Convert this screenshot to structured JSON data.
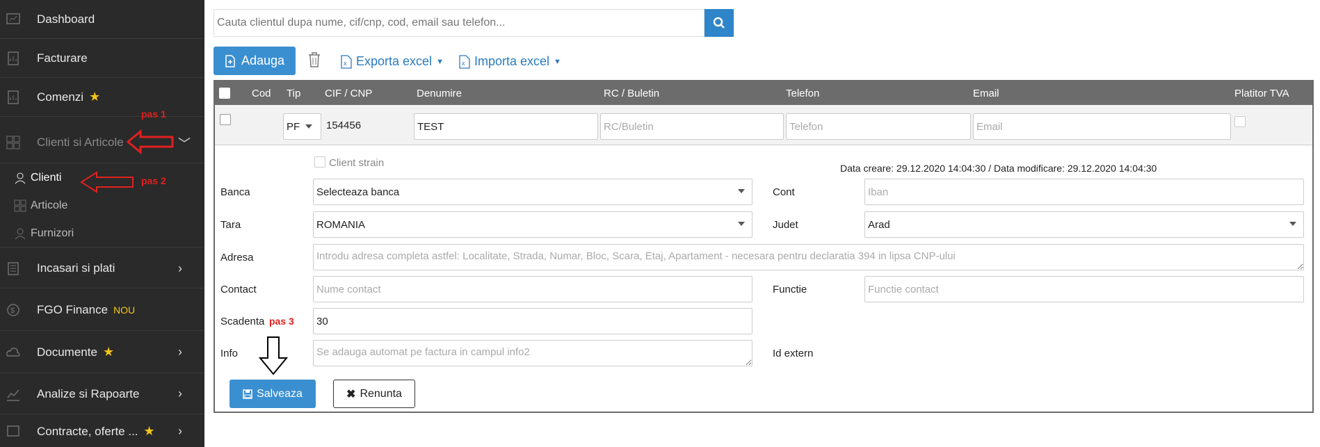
{
  "sidebar": {
    "items": [
      {
        "label": "Dashboard"
      },
      {
        "label": "Facturare"
      },
      {
        "label": "Comenzi"
      },
      {
        "label": "Clienti si Articole",
        "chevron": "﹀"
      },
      {
        "label": "Incasari si plati",
        "chevron": "›"
      },
      {
        "label": "FGO Finance",
        "badge": "NOU"
      },
      {
        "label": "Documente",
        "chevron": "›"
      },
      {
        "label": "Analize si Rapoarte",
        "chevron": "›"
      },
      {
        "label": "Contracte, oferte ...",
        "chevron": "›"
      }
    ],
    "sub_items": [
      {
        "label": "Clienti"
      },
      {
        "label": "Articole"
      },
      {
        "label": "Furnizori"
      }
    ]
  },
  "annotations": {
    "pas1": "pas 1",
    "pas2": "pas 2",
    "pas3": "pas 3"
  },
  "search": {
    "placeholder": "Cauta clientul dupa nume, cif/cnp, cod, email sau telefon..."
  },
  "toolbar": {
    "add_label": "Adauga",
    "export_label": "Exporta excel",
    "import_label": "Importa excel"
  },
  "table": {
    "headers": [
      "Cod",
      "Tip",
      "CIF / CNP",
      "Denumire",
      "RC / Buletin",
      "Telefon",
      "Email",
      "Platitor TVA"
    ],
    "row": {
      "tip": "PF",
      "cif": "154456",
      "denumire": "TEST",
      "rc_placeholder": "RC/Buletin",
      "telefon_placeholder": "Telefon",
      "email_placeholder": "Email"
    }
  },
  "form": {
    "client_strain": "Client strain",
    "dates": "Data creare: 29.12.2020 14:04:30  / Data modificare: 29.12.2020 14:04:30",
    "banca_label": "Banca",
    "banca_value": "Selecteaza banca",
    "cont_label": "Cont",
    "cont_placeholder": "Iban",
    "tara_label": "Tara",
    "tara_value": "ROMANIA",
    "judet_label": "Judet",
    "judet_value": "Arad",
    "adresa_label": "Adresa",
    "adresa_placeholder": "Introdu adresa completa astfel: Localitate, Strada, Numar, Bloc, Scara, Etaj, Apartament - necesara pentru declaratia 394 in lipsa CNP-ului",
    "contact_label": "Contact",
    "contact_placeholder": "Nume contact",
    "functie_label": "Functie",
    "functie_placeholder": "Functie contact",
    "scadenta_label": "Scadenta",
    "scadenta_value": "30",
    "info_label": "Info",
    "info_placeholder": "Se adauga automat pe factura in campul info2",
    "id_extern_label": "Id extern"
  },
  "actions": {
    "save_label": "Salveaza",
    "cancel_label": "Renunta"
  },
  "colors": {
    "primary": "#3a8fd1",
    "sidebar": "#2a2a2a",
    "header": "#6c6c6c",
    "star": "#f5c518",
    "annotation": "#e02020"
  }
}
